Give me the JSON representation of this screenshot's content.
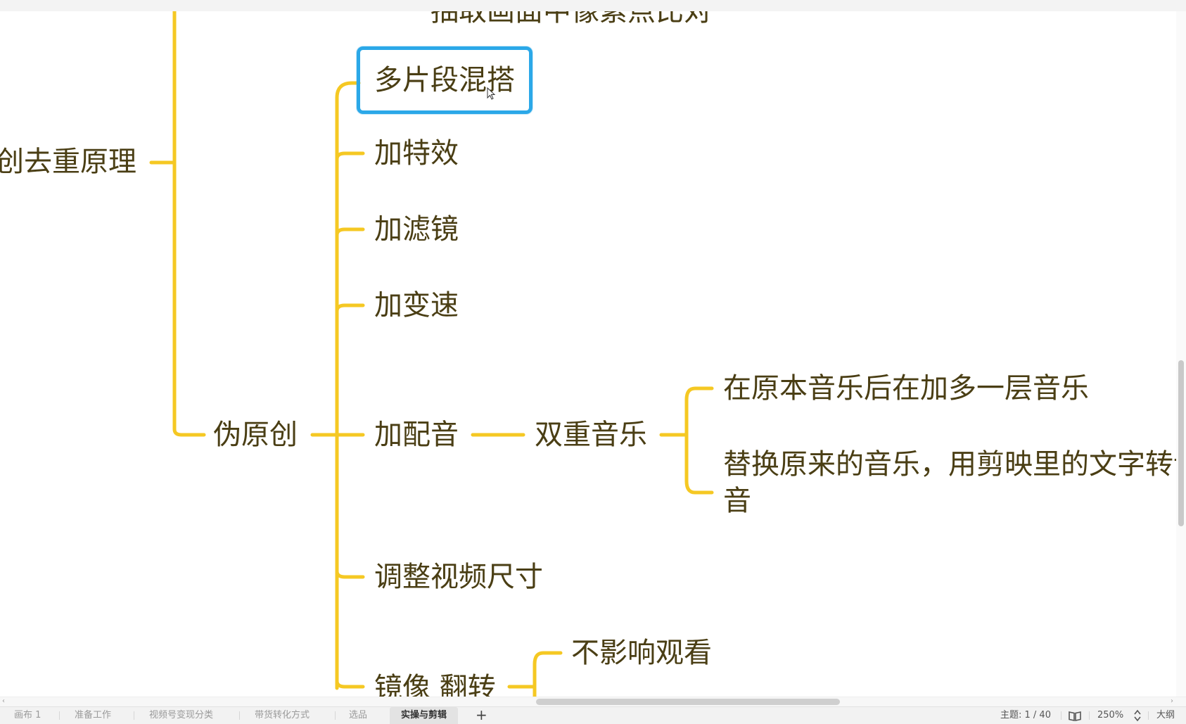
{
  "mindmap": {
    "top_cut_text": "抽取画面中像素点比对",
    "root": "创去重原理",
    "branch": "伪原创",
    "children": [
      "多片段混搭",
      "加特效",
      "加滤镜",
      "加变速",
      "加配音",
      "调整视频尺寸",
      "镜像 翻转"
    ],
    "dub_child": "双重音乐",
    "music_options": [
      "在原本音乐后在加多一层音乐",
      "替换原来的音乐，用剪映里的文字转语",
      "音"
    ],
    "mirror_child": "不影响观看",
    "selected_node": "多片段混搭"
  },
  "colors": {
    "connector": "#f5c823",
    "selection_border": "#2ba8e8",
    "node_text": "#4a3e14"
  },
  "sheet_tabs": [
    "画布 1",
    "准备工作",
    "视频号变现分类",
    "带货转化方式",
    "选品",
    "实操与剪辑"
  ],
  "active_sheet": "实操与剪辑",
  "add_sheet_label": "+",
  "status": {
    "topic_count": "主题: 1 / 40",
    "zoom": "250%",
    "outline": "大纲"
  },
  "icons": {
    "book": "book-icon",
    "zoom_stepper": "zoom-stepper-icon",
    "cursor": "mouse-cursor-icon"
  }
}
